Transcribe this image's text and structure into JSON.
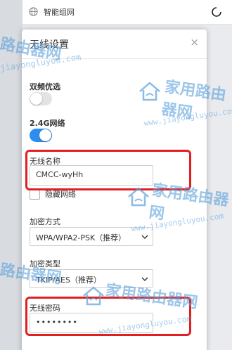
{
  "topbar": {
    "title": "智能组网",
    "globe_icon": "globe-icon",
    "spinner_icon": "loading-spinner-icon"
  },
  "modal": {
    "title": "无线设置",
    "close_label": "×",
    "dual_band": {
      "label": "双频优选",
      "enabled": false
    },
    "band_24g": {
      "label": "2.4G网络",
      "enabled": true
    },
    "ssid": {
      "label": "无线名称",
      "value": "CMCC-wyHh"
    },
    "hide_network": {
      "label": "隐藏网络",
      "checked": false
    },
    "encryption_mode": {
      "label": "加密方式",
      "value": "WPA/WPA2-PSK（推荐）"
    },
    "encryption_type": {
      "label": "加密类型",
      "value": "TKIP/AES（推荐）"
    },
    "password": {
      "label": "无线密码",
      "value": "••••••••"
    }
  },
  "watermark": {
    "text_cn_1": "家用路由器网",
    "text_en": "www.jiayongluyou.com",
    "text_cn_short": "路由器网",
    "text_en_short": "jiayongluyou.com"
  },
  "colors": {
    "accent": "#2d8cf0",
    "highlight": "#e02020",
    "watermark": "#5aa0dc"
  }
}
